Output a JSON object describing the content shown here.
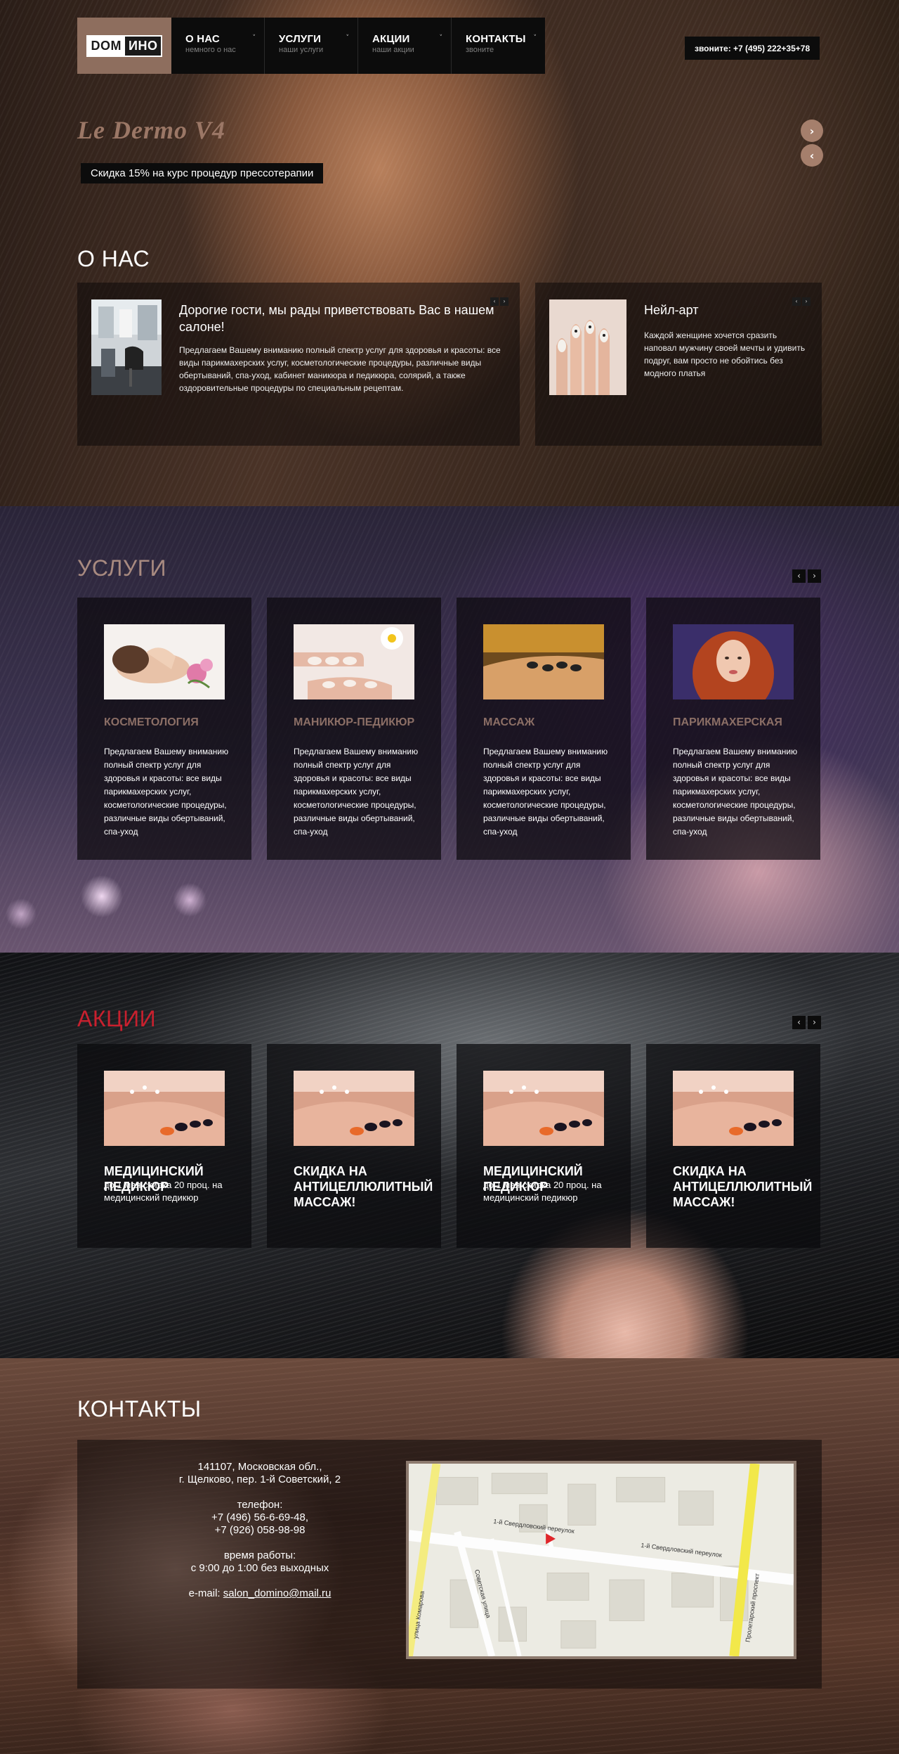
{
  "header": {
    "logo": {
      "part1": "DOM",
      "part2": "ИНО"
    },
    "nav": [
      {
        "title": "О НАС",
        "sub": "немного о нас",
        "chev": "˅"
      },
      {
        "title": "УСЛУГИ",
        "sub": "наши услуги",
        "chev": "˅"
      },
      {
        "title": "АКЦИИ",
        "sub": "наши акции",
        "chev": "˅"
      },
      {
        "title": "КОНТАКТЫ",
        "sub": "звоните",
        "chev": "˅"
      }
    ],
    "phone": "звоните: +7 (495) 222+35+78"
  },
  "slider": {
    "title": "Le Dermo V4",
    "caption": "Скидка 15% на курс процедур прессотерапии",
    "next": "›",
    "prev": "‹"
  },
  "about": {
    "title": "О НАС",
    "cards": [
      {
        "title": "Дорогие гости, мы рады приветствовать Вас в нашем салоне!",
        "text": "Предлагаем Вашему вниманию полный спектр услуг для здоровья и красоты: все виды парикмахерских услуг, косметологические процедуры, различные виды обертываний, спа-уход, кабинет маникюра и педикюра, солярий, а также оздоровительные процедуры по специальным рецептам.",
        "prev": "‹",
        "next": "›"
      },
      {
        "title": "Нейл-арт",
        "text": "Каждой женщине хочется сразить наповал мужчину своей мечты и удивить подруг, вам просто не обойтись без модного платья",
        "prev": "‹",
        "next": "›"
      }
    ]
  },
  "services": {
    "title": "УСЛУГИ",
    "prev": "‹",
    "next": "›",
    "items": [
      {
        "title": "КОСМЕТОЛОГИЯ",
        "text": "Предлагаем Вашему вниманию полный спектр услуг для здоровья и красоты: все виды парикмахерских услуг, косметологические процедуры, различные виды обертываний, спа-уход"
      },
      {
        "title": "МАНИКЮР-ПЕДИКЮР",
        "text": "Предлагаем Вашему вниманию полный спектр услуг для здоровья и красоты: все виды парикмахерских услуг, косметологические процедуры, различные виды обертываний, спа-уход"
      },
      {
        "title": "МАССАЖ",
        "text": "Предлагаем Вашему вниманию полный спектр услуг для здоровья и красоты: все виды парикмахерских услуг, косметологические процедуры, различные виды обертываний, спа-уход"
      },
      {
        "title": "ПАРИКМАХЕРСКАЯ",
        "text": "Предлагаем Вашему вниманию полный спектр услуг для здоровья и красоты: все виды парикмахерских услуг, косметологические процедуры, различные виды обертываний, спа-уход"
      }
    ]
  },
  "promos": {
    "title": "АКЦИИ",
    "title_color": "#c8202e",
    "prev": "‹",
    "next": "›",
    "items": [
      {
        "title": "Медицинский педикюр",
        "text": "до 1 мая скидка 20 проц. на медицинский педикюр"
      },
      {
        "title": "Скидка на антицеллюлитный массаж!",
        "text": ""
      },
      {
        "title": "Медицинский педикюр",
        "text": "до 1 мая скидка 20 проц. на медицинский педикюр"
      },
      {
        "title": "Скидка на антицеллюлитный массаж!",
        "text": ""
      }
    ]
  },
  "contacts": {
    "title": "КОНТАКТЫ",
    "address_1": "141107, Московская обл.,",
    "address_2": "г. Щелково, пер. 1-й Советский, 2",
    "phone_label": "телефон:",
    "phone_1": "+7 (496) 56-6-69-48,",
    "phone_2": "+7 (926) 058-98-98",
    "hours_label": "время работы:",
    "hours": "с 9:00 до 1:00 без выходных",
    "email_label": "e-mail:",
    "email": "salon_domino@mail.ru",
    "map": {
      "street_1": "1-й Свердловский переулок",
      "street_2": "улица Комарова",
      "street_3": "Советская улица",
      "street_4": "Пролетарский проспект"
    }
  },
  "colors": {
    "accent_brown": "#a57f6c",
    "service_title": "#8c6f66",
    "panel_dark": "#0c0c0c"
  }
}
